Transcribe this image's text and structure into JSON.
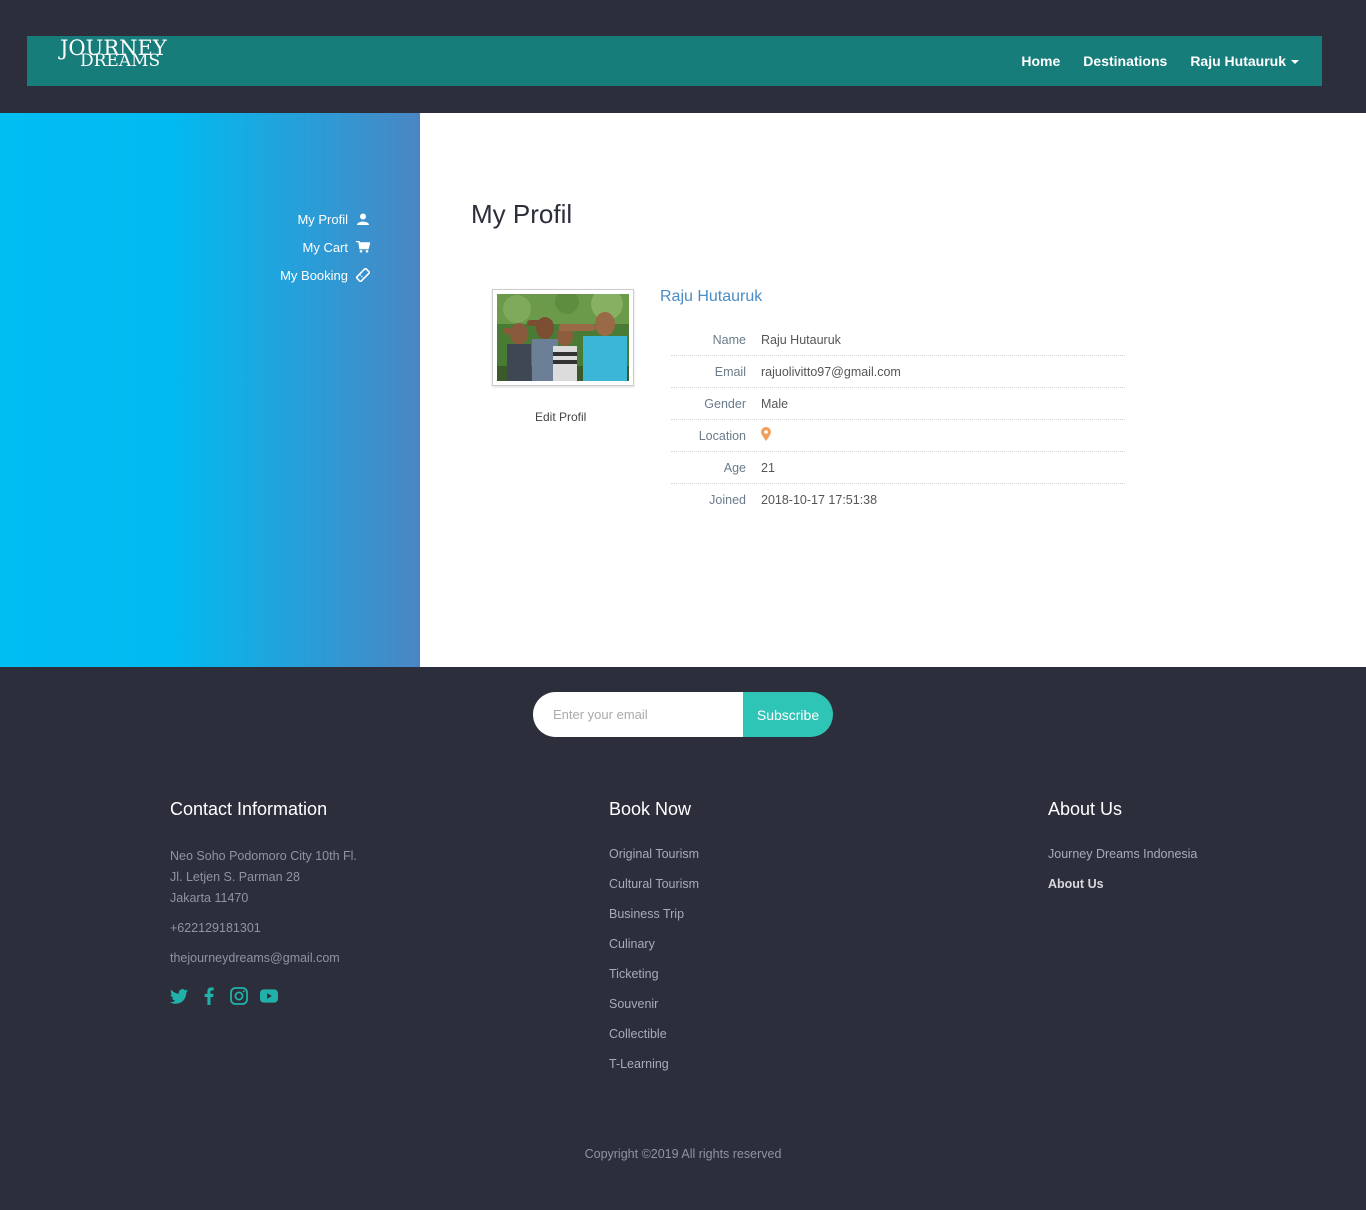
{
  "brand": {
    "line1": "JOURNEY",
    "line2": "DREAMS"
  },
  "nav": {
    "home": "Home",
    "destinations": "Destinations",
    "user": "Raju Hutauruk"
  },
  "sidebar": {
    "items": [
      {
        "label": "My Profil",
        "icon": "user-icon"
      },
      {
        "label": "My Cart",
        "icon": "cart-icon"
      },
      {
        "label": "My Booking",
        "icon": "ticket-icon"
      }
    ]
  },
  "profile": {
    "page_title": "My Profil",
    "name_heading": "Raju Hutauruk",
    "edit_label": "Edit Profil",
    "fields": [
      {
        "label": "Name",
        "value": "Raju Hutauruk"
      },
      {
        "label": "Email",
        "value": "rajuolivitto97@gmail.com"
      },
      {
        "label": "Gender",
        "value": "Male"
      },
      {
        "label": "Location",
        "value": ""
      },
      {
        "label": "Age",
        "value": "21"
      },
      {
        "label": "Joined",
        "value": "2018-10-17 17:51:38"
      }
    ]
  },
  "subscribe": {
    "placeholder": "Enter your email",
    "button": "Subscribe"
  },
  "footer": {
    "contact": {
      "title": "Contact Information",
      "address1": "Neo Soho Podomoro City 10th Fl.",
      "address2": "Jl. Letjen S. Parman 28",
      "address3": "Jakarta 11470",
      "phone": "+622129181301",
      "email": "thejourneydreams@gmail.com"
    },
    "book": {
      "title": "Book Now",
      "links": [
        "Original Tourism",
        "Cultural Tourism",
        "Business Trip",
        "Culinary",
        "Ticketing",
        "Souvenir",
        "Collectible",
        "T-Learning"
      ]
    },
    "about": {
      "title": "About Us",
      "links": [
        "Journey Dreams Indonesia",
        "About Us"
      ]
    },
    "copyright": "Copyright ©2019 All rights reserved"
  },
  "colors": {
    "navbar": "#167d7b",
    "accent": "#2ec4b6",
    "dark": "#2c2e3b",
    "link": "#4a8ec6"
  }
}
